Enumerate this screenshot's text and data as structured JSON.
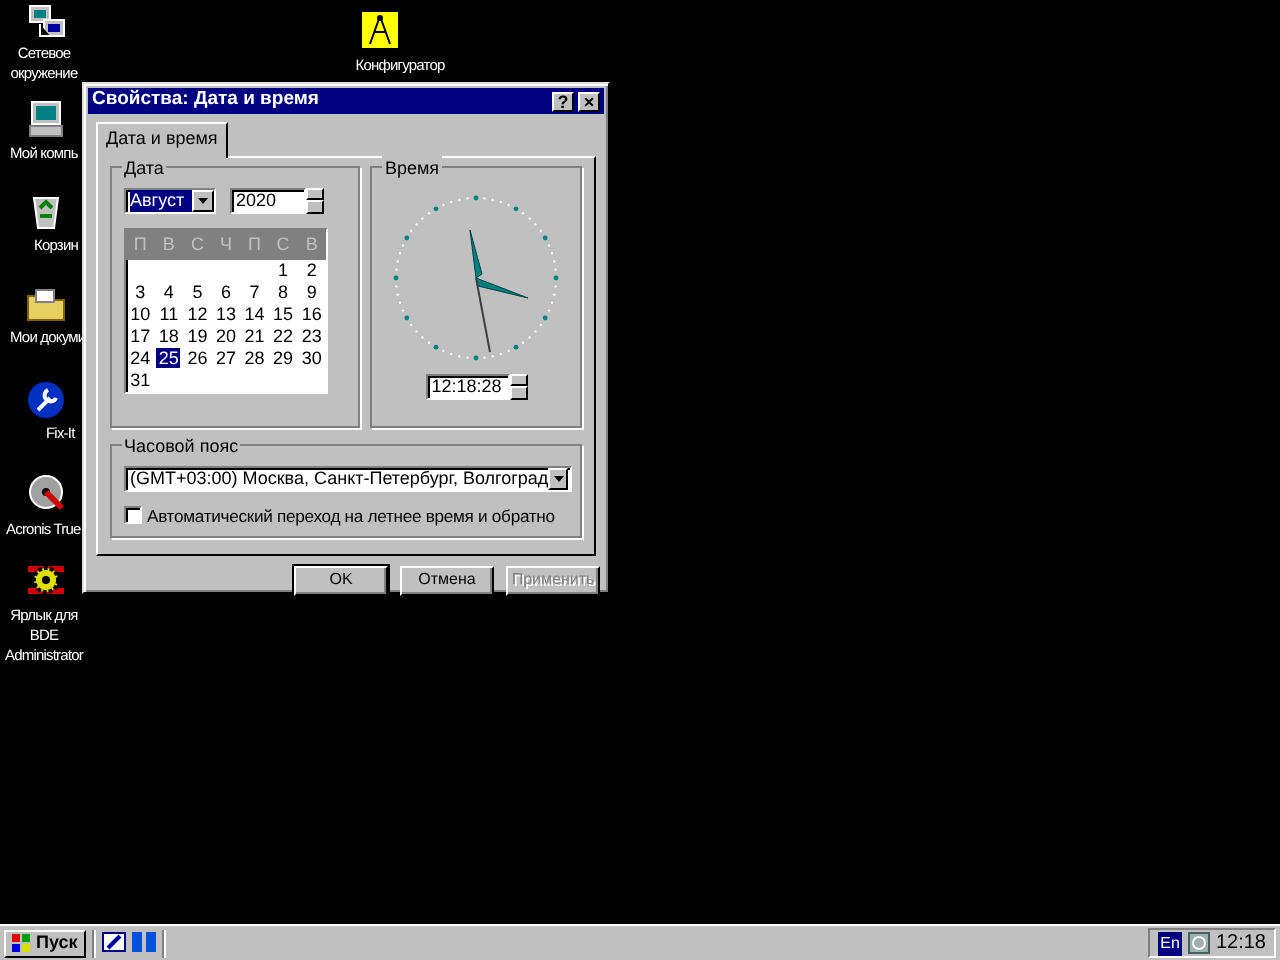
{
  "desktop_icons": [
    {
      "label": "Сетевое окружение",
      "kind": "network"
    },
    {
      "label": "Конфигуратор",
      "kind": "configurator"
    },
    {
      "label": "Мой компь",
      "kind": "computer"
    },
    {
      "label": "Корзин",
      "kind": "recycle"
    },
    {
      "label": "Мои докуми",
      "kind": "documents"
    },
    {
      "label": "Fix-It",
      "kind": "fixit"
    },
    {
      "label": "Acronis True",
      "kind": "acronis"
    },
    {
      "label": "Ярлык для BDE Administrator",
      "kind": "bde"
    }
  ],
  "dialog": {
    "title": "Свойства: Дата и время",
    "title_buttons": [
      "?",
      "×"
    ],
    "tabs": [
      {
        "label": "Дата и время",
        "selected": true
      }
    ],
    "date_group": {
      "title": "Дата",
      "month": "Август",
      "year": "2020",
      "weekdays": [
        "П",
        "В",
        "С",
        "Ч",
        "П",
        "С",
        "В"
      ],
      "weeks": [
        [
          {
            "label": "1",
            "selected": false
          },
          {
            "label": "2",
            "selected": false
          }
        ],
        [
          {
            "label": "3",
            "selected": false
          },
          {
            "label": "4",
            "selected": false
          },
          {
            "label": "5",
            "selected": false
          },
          {
            "label": "6",
            "selected": false
          },
          {
            "label": "7",
            "selected": false
          },
          {
            "label": "8",
            "selected": false
          },
          {
            "label": "9",
            "selected": false
          }
        ],
        [
          {
            "label": "10",
            "selected": false
          },
          {
            "label": "11",
            "selected": false
          },
          {
            "label": "12",
            "selected": false
          },
          {
            "label": "13",
            "selected": false
          },
          {
            "label": "14",
            "selected": false
          },
          {
            "label": "15",
            "selected": false
          },
          {
            "label": "16",
            "selected": false
          }
        ],
        [
          {
            "label": "17",
            "selected": false
          },
          {
            "label": "18",
            "selected": false
          },
          {
            "label": "19",
            "selected": false
          },
          {
            "label": "20",
            "selected": false
          },
          {
            "label": "21",
            "selected": false
          },
          {
            "label": "22",
            "selected": false
          },
          {
            "label": "23",
            "selected": false
          }
        ],
        [
          {
            "label": "24",
            "selected": false
          },
          {
            "label": "25",
            "selected": true
          },
          {
            "label": "26",
            "selected": false
          },
          {
            "label": "27",
            "selected": false
          },
          {
            "label": "28",
            "selected": false
          },
          {
            "label": "29",
            "selected": false
          },
          {
            "label": "30",
            "selected": false
          }
        ],
        [
          {
            "label": "31",
            "selected": false
          }
        ]
      ]
    },
    "time_group": {
      "title": "Время",
      "time": "12:18:28"
    },
    "timezone_group": {
      "title": "Часовой пояс",
      "timezone": "(GMT+03:00) Москва, Санкт-Петербург, Волгоград",
      "dst_checkbox": {
        "label": "Автоматический переход на летнее время и обратно",
        "checked": false
      }
    },
    "buttons": [
      {
        "label": "OK",
        "disabled": false,
        "default": true
      },
      {
        "label": "Отмена",
        "disabled": false,
        "default": false
      },
      {
        "label": "Применить",
        "disabled": true,
        "default": false
      }
    ]
  },
  "taskbar": {
    "start": "Пуск",
    "language": "En",
    "clock": "12:18"
  }
}
